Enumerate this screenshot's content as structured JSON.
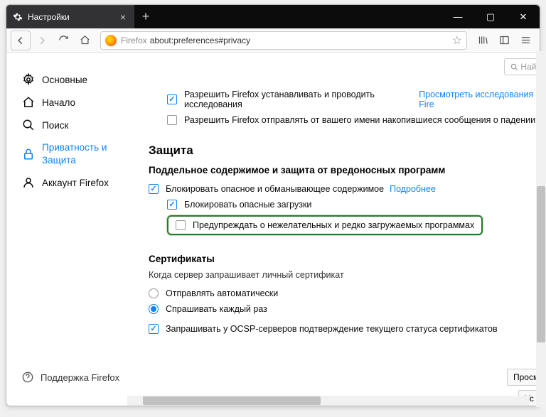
{
  "window": {
    "tab_title": "Настройки",
    "new_tab": "+"
  },
  "navbar": {
    "firefox_label": "Firefox",
    "url": "about:preferences#privacy"
  },
  "search": {
    "placeholder": "Най"
  },
  "sidebar": {
    "items": [
      {
        "label": "Основные"
      },
      {
        "label": "Начало"
      },
      {
        "label": "Поиск"
      },
      {
        "label": "Приватность и Защита"
      },
      {
        "label": "Аккаунт Firefox"
      }
    ],
    "support": "Поддержка Firefox"
  },
  "main": {
    "research_allow": "Разрешить Firefox устанавливать и проводить исследования",
    "research_link": "Просмотреть исследования Fire",
    "crash_allow": "Разрешить Firefox отправлять от вашего имени накопившиеся сообщения о падении",
    "section_protection": "Защита",
    "heading_malware": "Поддельное содержимое и защита от вредоносных программ",
    "block_dangerous": "Блокировать опасное и обманывающее содержимое",
    "learn_more": "Подробнее",
    "block_downloads": "Блокировать опасные загрузки",
    "warn_unwanted": "Предупреждать о нежелательных и редко загружаемых программах",
    "section_certs": "Сертификаты",
    "certs_desc": "Когда сервер запрашивает личный сертификат",
    "certs_auto": "Отправлять автоматически",
    "certs_ask": "Спрашивать каждый раз",
    "certs_ocsp": "Запрашивать у OCSP-серверов подтверждение текущего статуса сертификатов",
    "btn_view": "Просм",
    "btn_sec": "Ус"
  }
}
